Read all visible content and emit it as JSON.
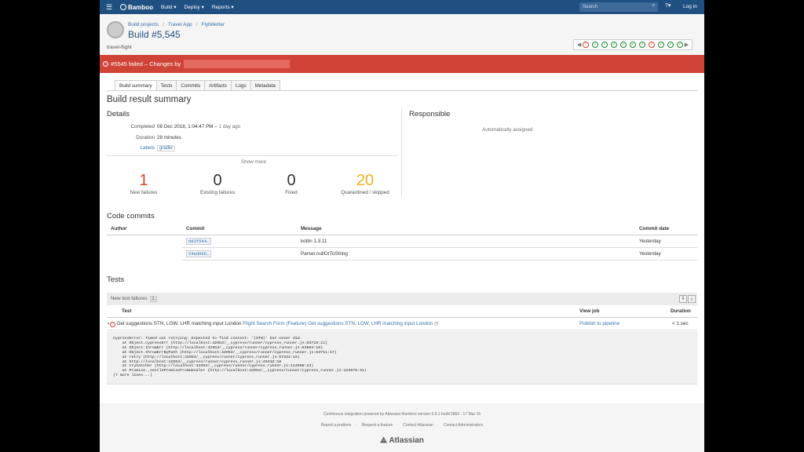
{
  "topnav": {
    "brand": "Bamboo",
    "items": [
      "Build",
      "Deploy",
      "Reports"
    ],
    "search_placeholder": "Search",
    "login": "Log in"
  },
  "header": {
    "breadcrumb": [
      "Build projects",
      "Travel App",
      "Flybilletter"
    ],
    "build_title": "Build #5,545",
    "plan_key": "travel-flight",
    "history": [
      "fail",
      "ok",
      "ok",
      "ok",
      "ok",
      "ok",
      "ok",
      "fail",
      "ok",
      "ok",
      "ok"
    ]
  },
  "banner": {
    "text": "#5545 failed – Changes by"
  },
  "tabs": [
    "Build summary",
    "Tests",
    "Commits",
    "Artifacts",
    "Logs",
    "Metadata"
  ],
  "summary": {
    "title": "Build result summary",
    "details_heading": "Details",
    "responsible_heading": "Responsible",
    "completed_label": "Completed",
    "completed_value": "08 Dec 2018, 1:04:47 PM",
    "completed_sep": "–",
    "completed_ago": "1 day ago",
    "duration_label": "Duration",
    "duration_value": "28 minutes",
    "labels_label": "Labels",
    "labels_value": "gradle",
    "responsible_value": "Automatically assigned",
    "show_more": "Show more"
  },
  "stats": [
    {
      "num": "1",
      "label": "New failures",
      "color": "#d04437"
    },
    {
      "num": "0",
      "label": "Existing failures",
      "color": "#333333"
    },
    {
      "num": "0",
      "label": "Fixed",
      "color": "#333333"
    },
    {
      "num": "20",
      "label": "Quarantined / skipped",
      "color": "#f6b020"
    }
  ],
  "commits": {
    "heading": "Code commits",
    "col_author": "Author",
    "col_commit": "Commit",
    "col_message": "Message",
    "col_date": "Commit date",
    "rows": [
      {
        "hash": "dd3f544…",
        "message": "kotlin 1.3.11",
        "date": "Yesterday"
      },
      {
        "hash": "24ed966…",
        "message": "Parser.nullOrToString",
        "date": "Yesterday"
      }
    ]
  },
  "tests": {
    "heading": "Tests",
    "bar_label": "New test failures",
    "bar_count": "1",
    "col_test": "Test",
    "col_view": "View job",
    "col_duration": "Duration",
    "row": {
      "name": "Get suggestions STN, LGW, LHR matching input London",
      "suite_link": "Flight Search Form (Feature) Get suggestions STN, LGW, LHR matching input London",
      "job": "Publish to pipeline",
      "duration": "< 1 sec"
    },
    "stack": "CypressError: Timed out retrying: Expected to find content: '(STN)' but never did.\n    at Object.cypressErr (http://localhost:42953/__cypress/runner/cypress_runner.js:63719:11)\n    at Object.throwErr (http://localhost:42953/__cypress/runner/cypress_runner.js:63684:18)\n    at Object.throwErrByPath (http://localhost:42953/__cypress/runner/cypress_runner.js:63711:17)\n    at retry (http://localhost:42953/__cypress/runner/cypress_runner.js:57322:16)\n    at http://localhost:42953/__cypress/runner/cypress_runner.js:49432:18\n    at tryCatcher (http://localhost:42953/__cypress/runner/cypress_runner.js:124968:23)\n    at Promise._settlePromiseFromHandler (http://localhost:42953/__cypress/runner/cypress_runner.js:122978:31)\n(7 more lines...)"
  },
  "footer": {
    "line1": "Continuous integration powered by Atlassian Bamboo version 5.8.1 build 5866 - 17 Mar 15",
    "links": [
      "Report a problem",
      "Request a feature",
      "Contact Atlassian",
      "Contact Administrators"
    ],
    "logo": "Atlassian"
  }
}
